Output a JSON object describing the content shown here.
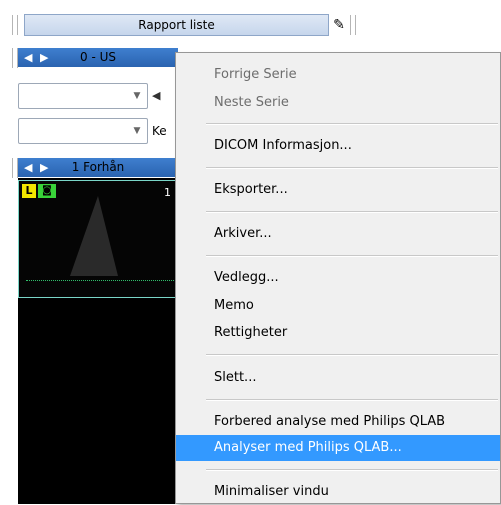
{
  "background": {
    "report_list_label": "Rapport liste",
    "series_bar_label": "0 - US",
    "key_label": "Ke",
    "group_bar_label": "1 Forhån",
    "badge_l": "L",
    "thumb_number": "1"
  },
  "context_menu": {
    "items": [
      {
        "label": "Forrige Serie",
        "mnemonic": "F",
        "enabled": false
      },
      {
        "label": "Neste Serie",
        "mnemonic": "N",
        "enabled": false
      },
      {
        "label": "DICOM Informasjon...",
        "mnemonic": "I",
        "enabled": true
      },
      {
        "label": "Eksporter...",
        "mnemonic": "E",
        "enabled": true
      },
      {
        "label": "Arkiver...",
        "mnemonic": "A",
        "enabled": true
      },
      {
        "label": "Vedlegg...",
        "mnemonic": "e",
        "enabled": true
      },
      {
        "label": "Memo",
        "mnemonic": "M",
        "enabled": true
      },
      {
        "label": "Rettigheter",
        "mnemonic": "R",
        "enabled": true
      },
      {
        "label": "Slett...",
        "mnemonic": "S",
        "enabled": true
      },
      {
        "label": "Forbered analyse med Philips QLAB",
        "mnemonic": "F",
        "enabled": true
      },
      {
        "label": "Analyser med Philips QLAB...",
        "mnemonic": "A",
        "enabled": true,
        "highlighted": true
      },
      {
        "label": "Minimaliser vindu",
        "mnemonic": "",
        "enabled": true
      }
    ]
  },
  "colors": {
    "highlight": "#3399ff",
    "nav_bar": "#2a63b0",
    "badge_yellow": "#f2e600",
    "badge_green": "#39d339"
  }
}
